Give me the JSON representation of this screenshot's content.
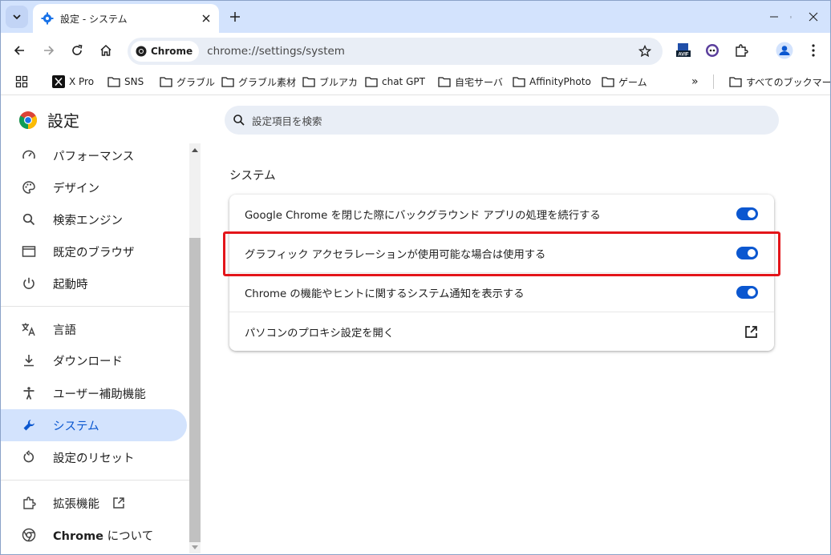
{
  "window": {
    "tab_title": "設定 - システム"
  },
  "toolbar": {
    "chip_label": "Chrome",
    "url": "chrome://settings/system",
    "extension_badge": "AVIF"
  },
  "bookmarks": {
    "items": [
      {
        "label": "X Pro",
        "icon": "x-icon"
      },
      {
        "label": "SNS",
        "icon": "folder-icon"
      },
      {
        "label": "グラブル",
        "icon": "folder-icon"
      },
      {
        "label": "グラブル素材",
        "icon": "folder-icon"
      },
      {
        "label": "ブルアカ",
        "icon": "folder-icon"
      },
      {
        "label": "chat GPT",
        "icon": "folder-icon"
      },
      {
        "label": "自宅サーバ",
        "icon": "folder-icon"
      },
      {
        "label": "AffinityPhoto",
        "icon": "folder-icon"
      },
      {
        "label": "ゲーム",
        "icon": "folder-icon"
      }
    ],
    "overflow": "»",
    "all_bookmarks": "すべてのブックマーク"
  },
  "sidebar": {
    "title": "設定",
    "items": [
      {
        "label": "パフォーマンス",
        "icon": "speedometer-icon"
      },
      {
        "label": "デザイン",
        "icon": "palette-icon"
      },
      {
        "label": "検索エンジン",
        "icon": "search-icon"
      },
      {
        "label": "既定のブラウザ",
        "icon": "browser-window-icon"
      },
      {
        "label": "起動時",
        "icon": "power-icon"
      },
      {
        "label": "言語",
        "icon": "translate-icon"
      },
      {
        "label": "ダウンロード",
        "icon": "download-icon"
      },
      {
        "label": "ユーザー補助機能",
        "icon": "accessibility-icon"
      },
      {
        "label": "システム",
        "icon": "wrench-icon",
        "active": true
      },
      {
        "label": "設定のリセット",
        "icon": "reset-icon"
      },
      {
        "label": "拡張機能",
        "icon": "puzzle-icon"
      },
      {
        "label_bold": "Chrome",
        "label_rest": " について",
        "icon": "chrome-icon"
      }
    ]
  },
  "main": {
    "search_placeholder": "設定項目を検索",
    "section_title": "システム",
    "rows": [
      {
        "label": "Google Chrome を閉じた際にバックグラウンド アプリの処理を続行する",
        "control": "toggle",
        "on": true
      },
      {
        "label": "グラフィック アクセラレーションが使用可能な場合は使用する",
        "control": "toggle",
        "on": true,
        "highlighted": true
      },
      {
        "label": "Chrome の機能やヒントに関するシステム通知を表示する",
        "control": "toggle",
        "on": true
      },
      {
        "label": "パソコンのプロキシ設定を開く",
        "control": "external-link"
      }
    ]
  },
  "colors": {
    "accent": "#0b57d0",
    "highlight_border": "#e3151a",
    "tabstrip": "#d3e3fd"
  }
}
